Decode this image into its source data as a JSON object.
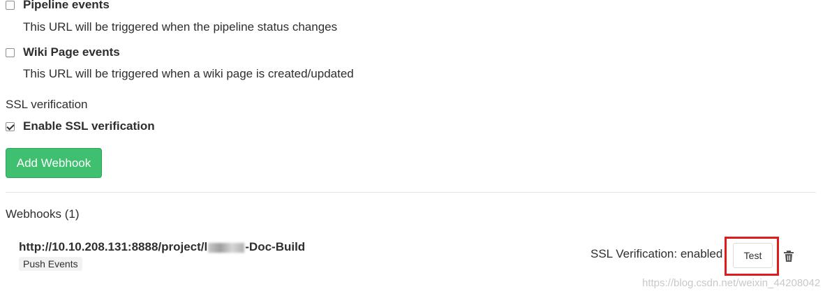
{
  "events": [
    {
      "label": "Pipeline events",
      "help": "This URL will be triggered when the pipeline status changes",
      "checked": false
    },
    {
      "label": "Wiki Page events",
      "help": "This URL will be triggered when a wiki page is created/updated",
      "checked": false
    }
  ],
  "ssl": {
    "section_label": "SSL verification",
    "checkbox_label": "Enable SSL verification",
    "checked": true
  },
  "add_button_label": "Add Webhook",
  "webhooks": {
    "title": "Webhooks (1)",
    "items": [
      {
        "url_prefix": "http://10.10.208.131:8888/project/l",
        "url_suffix": "-Doc-Build",
        "badge": "Push Events",
        "ssl_status": "SSL Verification: enabled",
        "test_label": "Test"
      }
    ]
  },
  "watermark": "https://blog.csdn.net/weixin_44208042",
  "colors": {
    "primary_green": "#3fbf70",
    "highlight_red": "#e01b1b"
  }
}
